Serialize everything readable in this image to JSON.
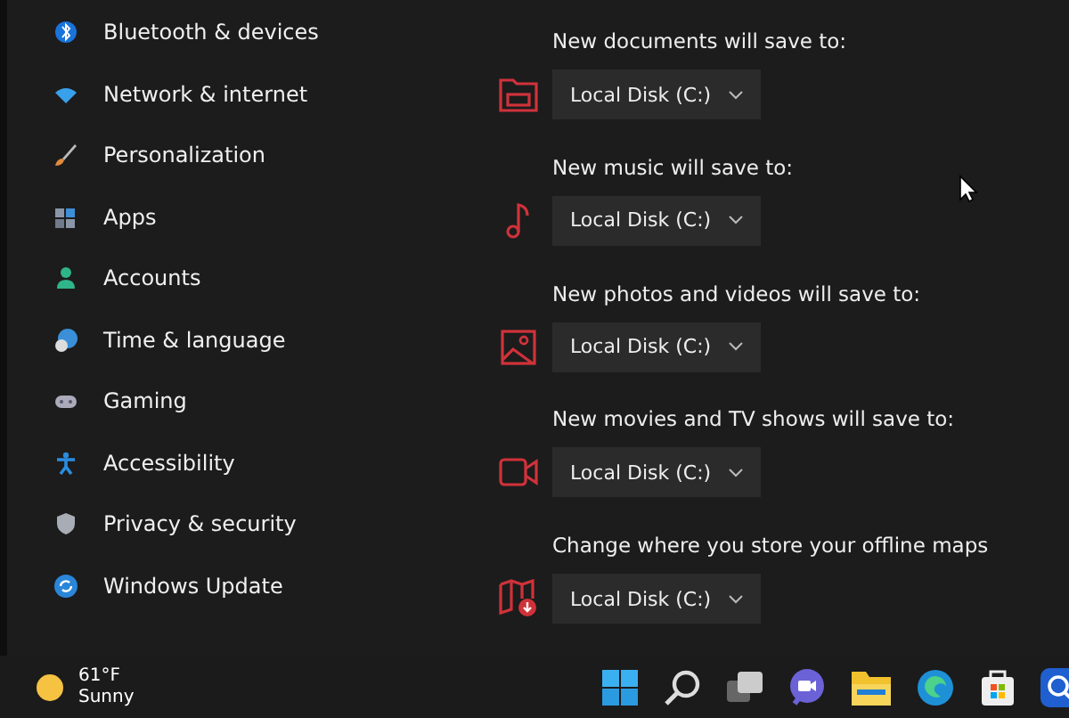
{
  "sidebar": {
    "items": [
      {
        "label": "Bluetooth & devices"
      },
      {
        "label": "Network & internet"
      },
      {
        "label": "Personalization"
      },
      {
        "label": "Apps"
      },
      {
        "label": "Accounts"
      },
      {
        "label": "Time & language"
      },
      {
        "label": "Gaming"
      },
      {
        "label": "Accessibility"
      },
      {
        "label": "Privacy & security"
      },
      {
        "label": "Windows Update"
      }
    ]
  },
  "save_locations": [
    {
      "label": "New documents will save to:",
      "value": "Local Disk (C:)"
    },
    {
      "label": "New music will save to:",
      "value": "Local Disk (C:)"
    },
    {
      "label": "New photos and videos will save to:",
      "value": "Local Disk (C:)"
    },
    {
      "label": "New movies and TV shows will save to:",
      "value": "Local Disk (C:)"
    },
    {
      "label": "Change where you store your offline maps",
      "value": "Local Disk (C:)"
    }
  ],
  "taskbar": {
    "weather": {
      "temperature": "61°F",
      "condition": "Sunny"
    }
  }
}
